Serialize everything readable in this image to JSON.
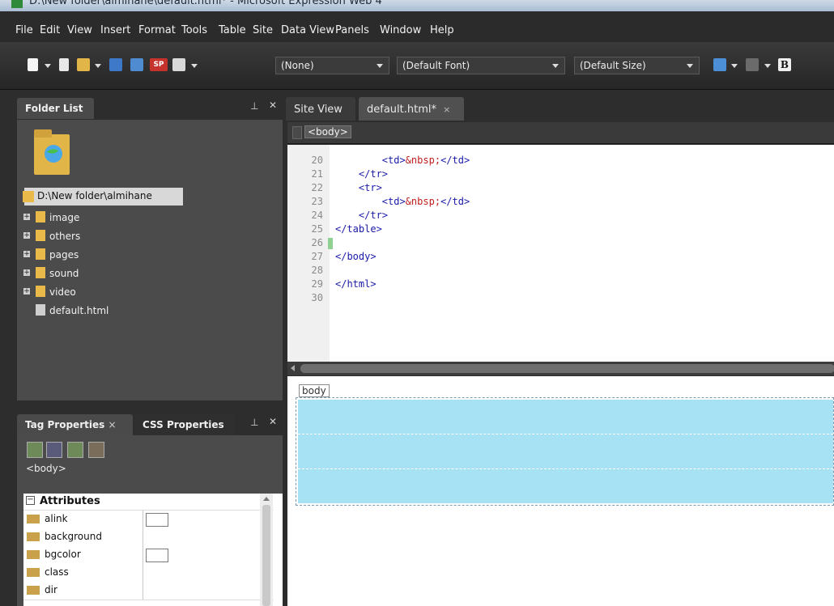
{
  "window": {
    "title": "D:\\New folder\\almihane\\default.html* - Microsoft Expression Web 4"
  },
  "menu": [
    "File",
    "Edit",
    "View",
    "Insert",
    "Format",
    "Tools",
    "Table",
    "Site",
    "Data View",
    "Panels",
    "Window",
    "Help"
  ],
  "toolbar": {
    "style_combo": "(None)",
    "font_combo": "(Default Font)",
    "size_combo": "(Default Size)",
    "bold_label": "B"
  },
  "folder_panel": {
    "tab_label": "Folder List",
    "root": "D:\\New folder\\almihane",
    "items": [
      {
        "label": "image",
        "type": "folder"
      },
      {
        "label": "others",
        "type": "folder"
      },
      {
        "label": "pages",
        "type": "folder"
      },
      {
        "label": "sound",
        "type": "folder"
      },
      {
        "label": "video",
        "type": "folder"
      },
      {
        "label": "default.html",
        "type": "file"
      }
    ]
  },
  "editor": {
    "tabs": [
      {
        "label": "Site View"
      },
      {
        "label": "default.html*",
        "close": "×"
      }
    ],
    "breadcrumb": "<body>",
    "lines": [
      {
        "n": "20",
        "text": "        <td>&nbsp;</td>"
      },
      {
        "n": "21",
        "text": "    </tr>"
      },
      {
        "n": "22",
        "text": "    <tr>"
      },
      {
        "n": "23",
        "text": "        <td>&nbsp;</td>"
      },
      {
        "n": "24",
        "text": "    </tr>"
      },
      {
        "n": "25",
        "text": "</table>"
      },
      {
        "n": "26",
        "text": ""
      },
      {
        "n": "27",
        "text": "</body>"
      },
      {
        "n": "28",
        "text": ""
      },
      {
        "n": "29",
        "text": "</html>"
      },
      {
        "n": "30",
        "text": ""
      }
    ],
    "design_tag": "body"
  },
  "tag_panel": {
    "tab1": "Tag Properties",
    "tab1_close": "×",
    "tab2": "CSS Properties",
    "selected_tag": "<body>",
    "group": "Attributes",
    "attributes": [
      {
        "name": "alink",
        "swatch": true
      },
      {
        "name": "background",
        "swatch": false
      },
      {
        "name": "bgcolor",
        "swatch": true
      },
      {
        "name": "class",
        "swatch": false
      },
      {
        "name": "dir",
        "swatch": false
      }
    ]
  },
  "colors": {
    "accent_tag": "#1a1aa8",
    "entity": "#c21d1d",
    "design_cell": "#a6e1f4",
    "folder": "#e9b94a"
  }
}
